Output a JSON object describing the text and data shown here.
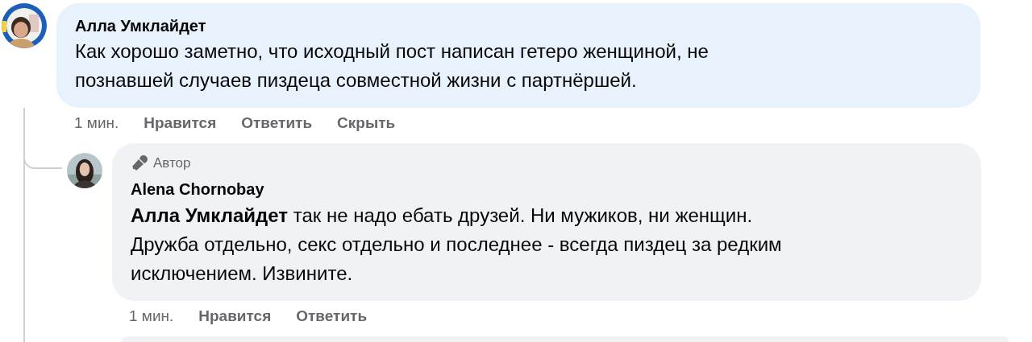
{
  "comment": {
    "author": "Алла Умклайдет",
    "text_lines": [
      "Как хорошо заметно, что исходный пост написан гетеро женщиной, не",
      "познавшей случаев пиздеца совместной жизни с партнёршей."
    ],
    "actions": [
      "1 мин.",
      "Нравится",
      "Ответить",
      "Скрыть"
    ],
    "replies": [
      {
        "badge": "Автор",
        "author": "Alena Chornobay",
        "text_lines": [
          "**Алла Умклайдет** так не надо ебать друзей. Ни мужиков, ни женщин.",
          "Дружба отдельно, секс отдельно и последнее - всегда пиздец за редким",
          "исключением. Извините."
        ],
        "actions": [
          "1 мин.",
          "Нравится",
          "Ответить"
        ]
      }
    ]
  }
}
